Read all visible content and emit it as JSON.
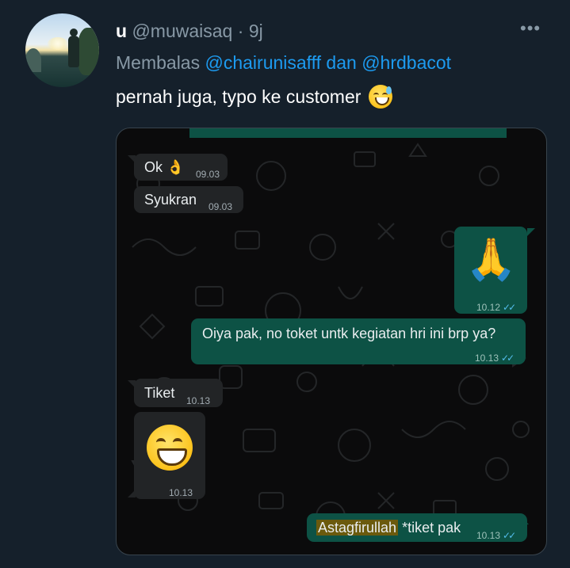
{
  "tweet": {
    "display_name": "u",
    "handle": "@muwaisaq",
    "separator": "·",
    "time": "9j",
    "more_icon": "more-horizontal-icon",
    "reply_prefix": "Membalas",
    "reply_to_1": "@chairunisafff",
    "reply_and": "dan",
    "reply_to_2": "@hrdbacot",
    "text": "pernah juga, typo ke customer",
    "text_emoji": "grinning-sweat-emoji"
  },
  "chat": {
    "messages": [
      {
        "side": "in",
        "text": "Ok",
        "emoji": "ok-hand-emoji",
        "time": "09.03"
      },
      {
        "side": "in",
        "text": "Syukran",
        "time": "09.03"
      },
      {
        "side": "out",
        "emoji": "folded-hands-emoji",
        "time": "10.12",
        "read": true
      },
      {
        "side": "out",
        "text": "Oiya pak, no toket untk kegiatan hri ini brp ya?",
        "time": "10.13",
        "read": true
      },
      {
        "side": "in",
        "text": "Tiket",
        "time": "10.13"
      },
      {
        "side": "in",
        "emoji": "grinning-face-emoji",
        "time": "10.13"
      },
      {
        "side": "out",
        "highlighted": "Astagfirullah",
        "text": " *tiket pak",
        "time": "10.13",
        "read": true
      }
    ],
    "read_ticks": "✓✓",
    "colors": {
      "incoming_bubble": "#222426",
      "outgoing_bubble": "#0d5245",
      "read_ticks": "#53bdeb",
      "highlight": "#6b5a0d"
    }
  }
}
